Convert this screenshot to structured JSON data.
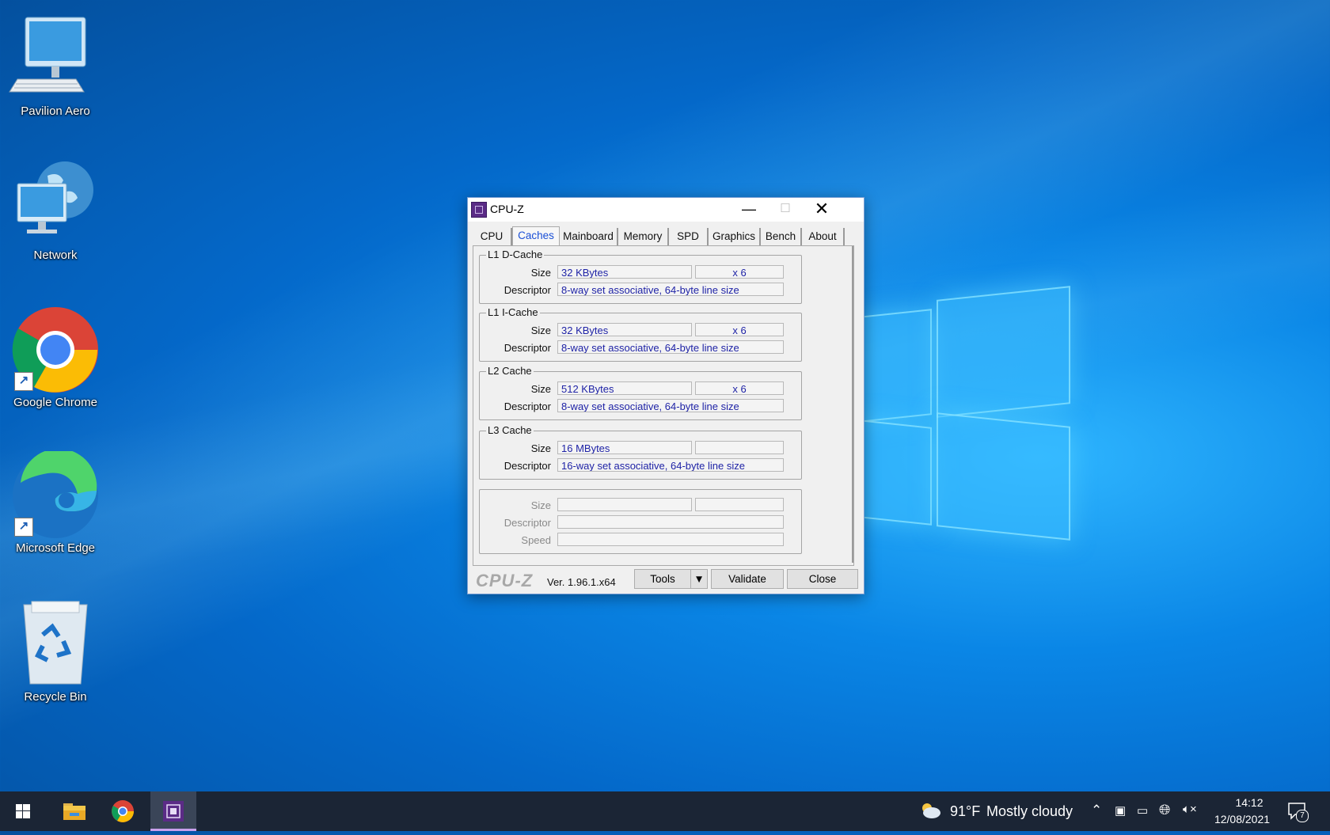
{
  "desktop": {
    "icons": [
      {
        "label": "Pavilion Aero",
        "icon": "computer-icon"
      },
      {
        "label": "Network",
        "icon": "network-icon"
      },
      {
        "label": "Google Chrome",
        "icon": "chrome-icon"
      },
      {
        "label": "Microsoft Edge",
        "icon": "edge-icon"
      },
      {
        "label": "Recycle Bin",
        "icon": "recycle-bin-icon"
      }
    ]
  },
  "window": {
    "title": "CPU-Z",
    "tabs": [
      "CPU",
      "Caches",
      "Mainboard",
      "Memory",
      "SPD",
      "Graphics",
      "Bench",
      "About"
    ],
    "active_tab": "Caches",
    "l1d": {
      "title": "L1 D-Cache",
      "size_label": "Size",
      "size": "32 KBytes",
      "count": "x 6",
      "descriptor_label": "Descriptor",
      "descriptor": "8-way set associative, 64-byte line size"
    },
    "l1i": {
      "title": "L1 I-Cache",
      "size_label": "Size",
      "size": "32 KBytes",
      "count": "x 6",
      "descriptor_label": "Descriptor",
      "descriptor": "8-way set associative, 64-byte line size"
    },
    "l2": {
      "title": "L2 Cache",
      "size_label": "Size",
      "size": "512 KBytes",
      "count": "x 6",
      "descriptor_label": "Descriptor",
      "descriptor": "8-way set associative, 64-byte line size"
    },
    "l3": {
      "title": "L3 Cache",
      "size_label": "Size",
      "size": "16 MBytes",
      "count": "",
      "descriptor_label": "Descriptor",
      "descriptor": "16-way set associative, 64-byte line size"
    },
    "extra": {
      "size_label": "Size",
      "descriptor_label": "Descriptor",
      "speed_label": "Speed"
    },
    "footer": {
      "brand": "CPU-Z",
      "version": "Ver. 1.96.1.x64",
      "tools": "Tools",
      "validate": "Validate",
      "close": "Close"
    }
  },
  "taskbar": {
    "weather_temp": "91°F",
    "weather_text": "Mostly cloudy",
    "time": "14:12",
    "date": "12/08/2021",
    "notifications": "7"
  },
  "colors": {
    "accent_tab": "#1a4fd6",
    "value_text": "#1f23a6",
    "taskbar": "#1b2535"
  }
}
